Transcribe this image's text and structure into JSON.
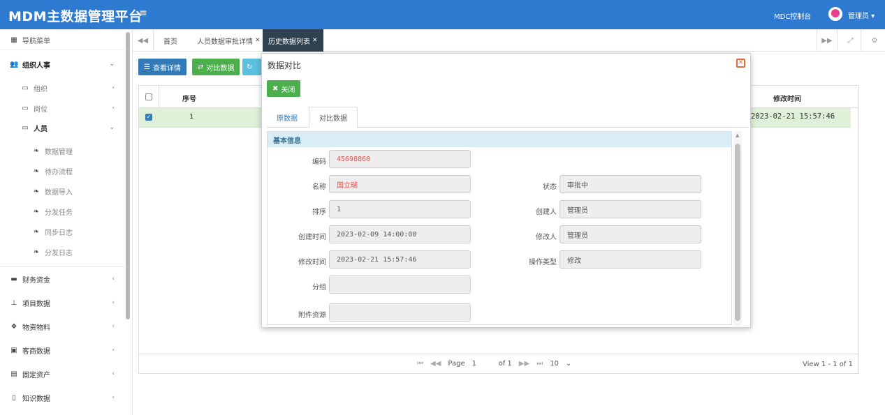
{
  "app": {
    "title": "MDM主数据管理平台",
    "menu_icon": "≡"
  },
  "topnav": {
    "console_link": "MDC控制台",
    "user": "管理员 ▾"
  },
  "sidebar": {
    "header": "导航菜单",
    "groups": [
      {
        "label": "组织人事",
        "icon": "users-icon",
        "expanded": true
      },
      {
        "label": "财务资金",
        "icon": "card-icon"
      },
      {
        "label": "项目数据",
        "icon": "sitemap-icon"
      },
      {
        "label": "物资物料",
        "icon": "cubes-icon"
      },
      {
        "label": "客商数据",
        "icon": "briefcase-icon"
      },
      {
        "label": "固定资产",
        "icon": "server-icon"
      },
      {
        "label": "知识数据",
        "icon": "file-icon"
      }
    ],
    "sub_items": [
      "组织",
      "岗位",
      "人员"
    ],
    "leaf_items": [
      "数据管理",
      "待办流程",
      "数据导入",
      "分发任务",
      "同步日志",
      "分发日志"
    ]
  },
  "tabs": [
    {
      "label": "首页"
    },
    {
      "label": "人员数据审批详情",
      "close": "✕"
    },
    {
      "label": "历史数据列表",
      "close": "✕",
      "active": true
    }
  ],
  "toolbar": {
    "view_details": "查看详情",
    "compare_data": "对比数据",
    "third_icon": "↻"
  },
  "grid": {
    "columns": [
      "序号",
      "修改时间"
    ],
    "rows": [
      {
        "index": "1",
        "modified": "2023-02-21 15:57:46",
        "selected": true
      }
    ],
    "pager": {
      "page_label": "Page",
      "page_value": "1",
      "of_label": "of 1",
      "page_size": "10"
    },
    "view_info": "View 1 - 1 of 1"
  },
  "modal": {
    "title": "数据对比",
    "close_button": "关闭",
    "tabs": [
      "原数据",
      "对比数据"
    ],
    "active_tab": "对比数据",
    "section_title": "基本信息",
    "fields_left": [
      {
        "label": "编码",
        "value": "45698860",
        "highlight": true
      },
      {
        "label": "名称",
        "value": "国立瑞",
        "highlight": true
      },
      {
        "label": "排序",
        "value": "1"
      },
      {
        "label": "创建时间",
        "value": "2023-02-09 14:00:00"
      },
      {
        "label": "修改时间",
        "value": "2023-02-21 15:57:46"
      },
      {
        "label": "分组",
        "value": ""
      },
      {
        "label": "附件资源",
        "value": ""
      }
    ],
    "fields_right": [
      {
        "label": "状态",
        "value": "审批中"
      },
      {
        "label": "创建人",
        "value": "管理员"
      },
      {
        "label": "修改人",
        "value": "管理员"
      },
      {
        "label": "操作类型",
        "value": "修改"
      }
    ]
  },
  "colors": {
    "topbar": "#2e7ad1",
    "primary": "#337ab7",
    "success": "#4cae4c",
    "info": "#5bc0de",
    "active_tab": "#2f4050",
    "highlight_text": "#d9534f"
  }
}
